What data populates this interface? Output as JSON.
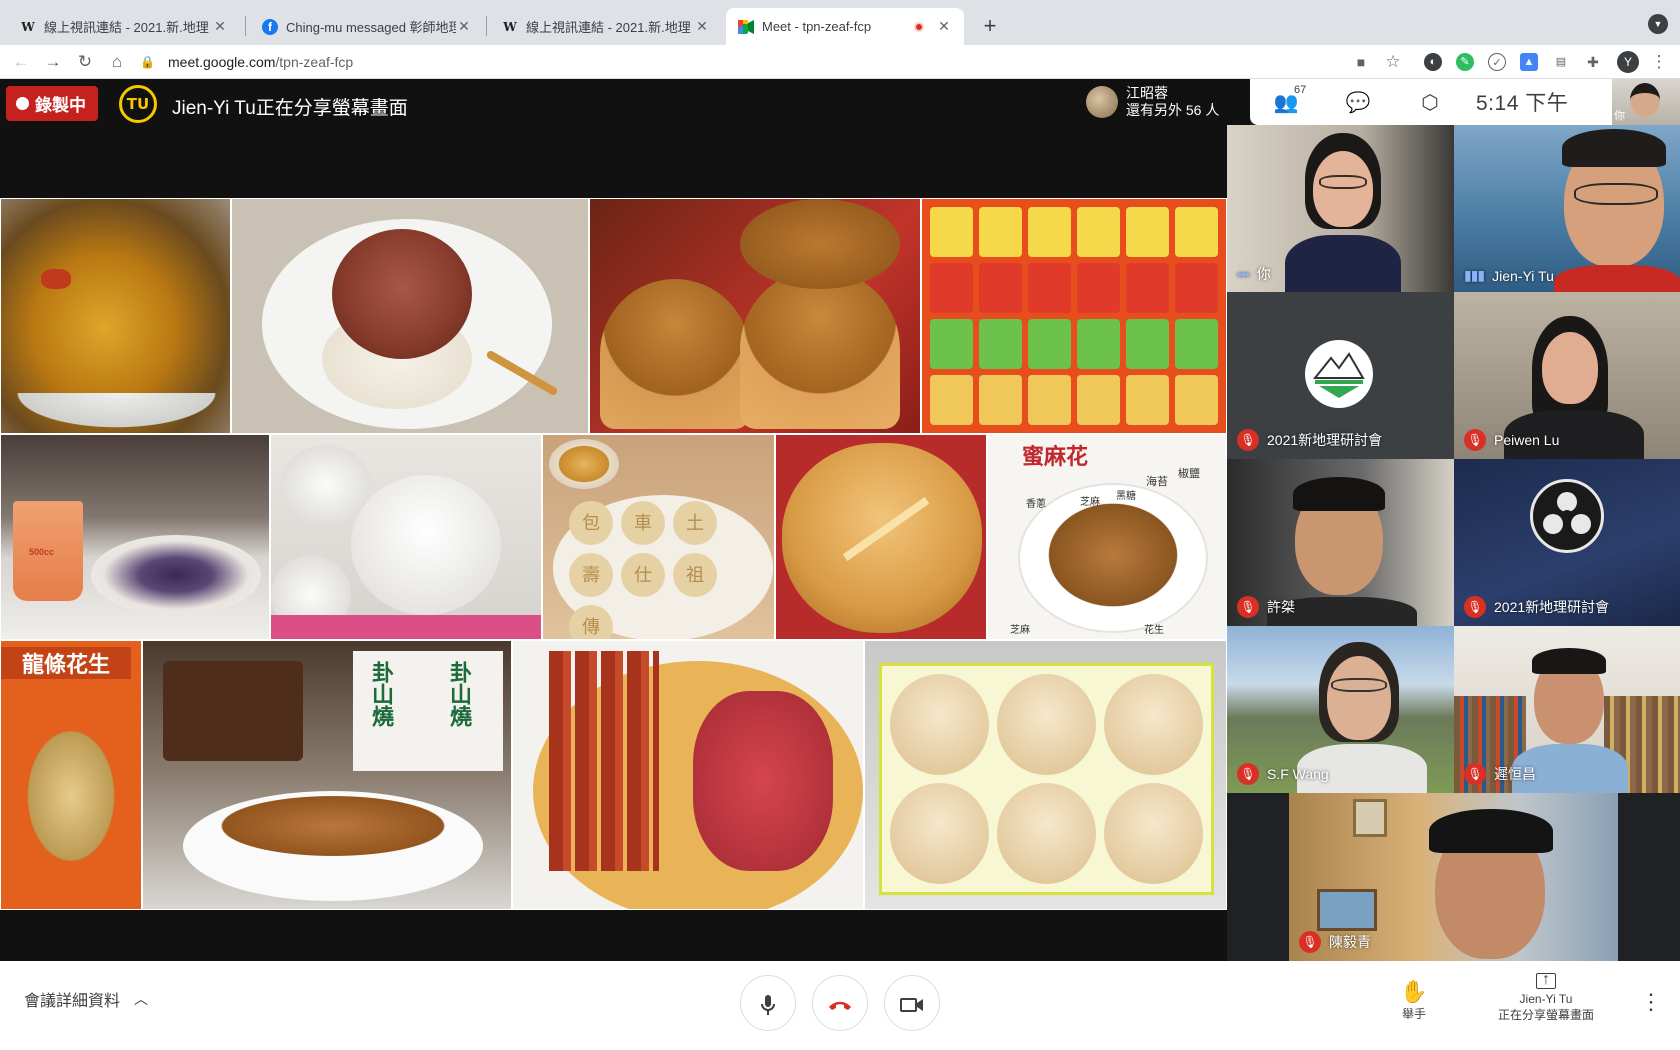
{
  "browser": {
    "tabs": [
      {
        "title": "線上視訊連結 - 2021.新.地理",
        "favicon": "W"
      },
      {
        "title": "Ching-mu messaged 彰師地理系",
        "favicon": "f"
      },
      {
        "title": "線上視訊連結 - 2021.新.地理",
        "favicon": "W"
      },
      {
        "title": "Meet - tpn-zeaf-fcp",
        "favicon": "M"
      }
    ],
    "close_glyph": "✕",
    "new_tab_glyph": "+",
    "url_host": "meet.google.com",
    "url_path": "/tpn-zeaf-fcp",
    "profile_initial": "Y"
  },
  "meet": {
    "recording_label": "錄製中",
    "presenter_avatar_text": "TU",
    "presenting_text": "Jien-Yi Tu正在分享螢幕畫面",
    "partbar": {
      "name": "江昭蓉",
      "others": "還有另外 56 人"
    },
    "participant_count": "67",
    "clock": "5:14 下午",
    "self_label": "你",
    "participants": [
      {
        "name": "你",
        "muted": false,
        "speaking": true
      },
      {
        "name": "Jien-Yi Tu",
        "muted": false,
        "speaking": true
      },
      {
        "name": "2021新地理研討會",
        "muted": true,
        "speaking": false
      },
      {
        "name": "Peiwen Lu",
        "muted": true,
        "speaking": false
      },
      {
        "name": "許桀",
        "muted": true,
        "speaking": false
      },
      {
        "name": "2021新地理研討會",
        "muted": true,
        "speaking": false
      },
      {
        "name": "S.F Wang",
        "muted": true,
        "speaking": false
      },
      {
        "name": "遲恒昌",
        "muted": true,
        "speaking": false
      },
      {
        "name": "陳毅青",
        "muted": true,
        "speaking": false
      }
    ],
    "food_captions": {
      "mahua_title": "蜜麻花",
      "mahua_labels": [
        "海苔",
        "椒鹽",
        "芝麻",
        "黑糖",
        "香蔥",
        "芝麻",
        "花生"
      ],
      "peanut_bag": "龍條花生",
      "cake_box": "卦山燒",
      "cake_box2": "卦山燒",
      "cup_text": "500cc",
      "pastry_stamps": [
        "包",
        "車",
        "土",
        "壽",
        "仕",
        "祖",
        "傳"
      ]
    }
  },
  "controls": {
    "details_label": "會議詳細資料",
    "raise_hand_label": "舉手",
    "present_line1": "Jien-Yi Tu",
    "present_line2": "正在分享螢幕畫面"
  }
}
